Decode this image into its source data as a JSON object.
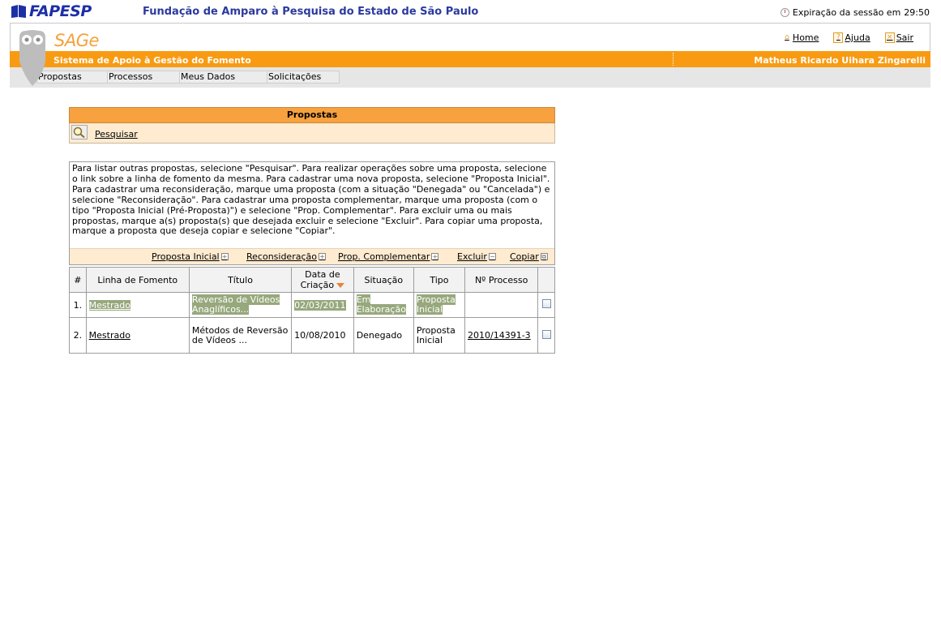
{
  "header": {
    "logo_text": "FAPESP",
    "organization": "Fundação de Amparo à Pesquisa do Estado de São Paulo",
    "session_label": "Expiração da sessão em",
    "session_time": "29:50"
  },
  "app": {
    "name": "SAGe",
    "subtitle": "Sistema de Apoio à Gestão do Fomento",
    "user": "Matheus Ricardo Uihara Zingarelli",
    "links": {
      "home": "Home",
      "help": "Ajuda",
      "exit": "Sair"
    },
    "menu": [
      "Propostas",
      "Processos",
      "Meus Dados",
      "Solicitações"
    ]
  },
  "panel": {
    "title": "Propostas",
    "search_link": "Pesquisar"
  },
  "info": {
    "message": "Para listar outras propostas, selecione \"Pesquisar\". Para realizar operações sobre uma proposta, selecione o link sobre a linha de fomento da mesma. Para cadastrar uma nova proposta, selecione \"Proposta Inicial\". Para cadastrar uma reconsideração, marque uma proposta (com a situação \"Denegada\" ou \"Cancelada\") e selecione \"Reconsideração\". Para cadastrar uma proposta complementar, marque uma proposta (com o tipo \"Proposta Inicial (Pré-Proposta)\") e selecione \"Prop. Complementar\". Para excluir uma ou mais propostas, marque a(s) proposta(s) que desejada excluir e selecione \"Excluir\". Para copiar uma proposta, marque a proposta que deseja copiar e selecione \"Copiar\".",
    "actions": {
      "initial": "Proposta Inicial",
      "reconsider": "Reconsideração",
      "complementary": "Prop. Complementar",
      "delete": "Excluir",
      "copy": "Copiar"
    }
  },
  "table": {
    "headers": {
      "num": "#",
      "line": "Linha de Fomento",
      "title": "Título",
      "date_1": "Data de",
      "date_2": "Criação",
      "status": "Situação",
      "type": "Tipo",
      "process": "Nº Processo"
    },
    "rows": [
      {
        "num": "1.",
        "line": "Mestrado",
        "title": "Reversão de Vídeos Anaglíficos...",
        "date": "02/03/2011",
        "status": "Em Elaboração",
        "type": "Proposta Inicial",
        "process": ""
      },
      {
        "num": "2.",
        "line": "Mestrado",
        "title": "Métodos de Reversão de Vídeos ...",
        "date": "10/08/2010",
        "status": "Denegado",
        "type": "Proposta Inicial",
        "process": "2010/14391-3"
      }
    ]
  },
  "colors": {
    "orange": "#f89b12",
    "panel_header": "#f7a13f",
    "panel_body": "#feebd0",
    "highlight": "#97a87c",
    "brand_blue": "#1c2fa6"
  }
}
